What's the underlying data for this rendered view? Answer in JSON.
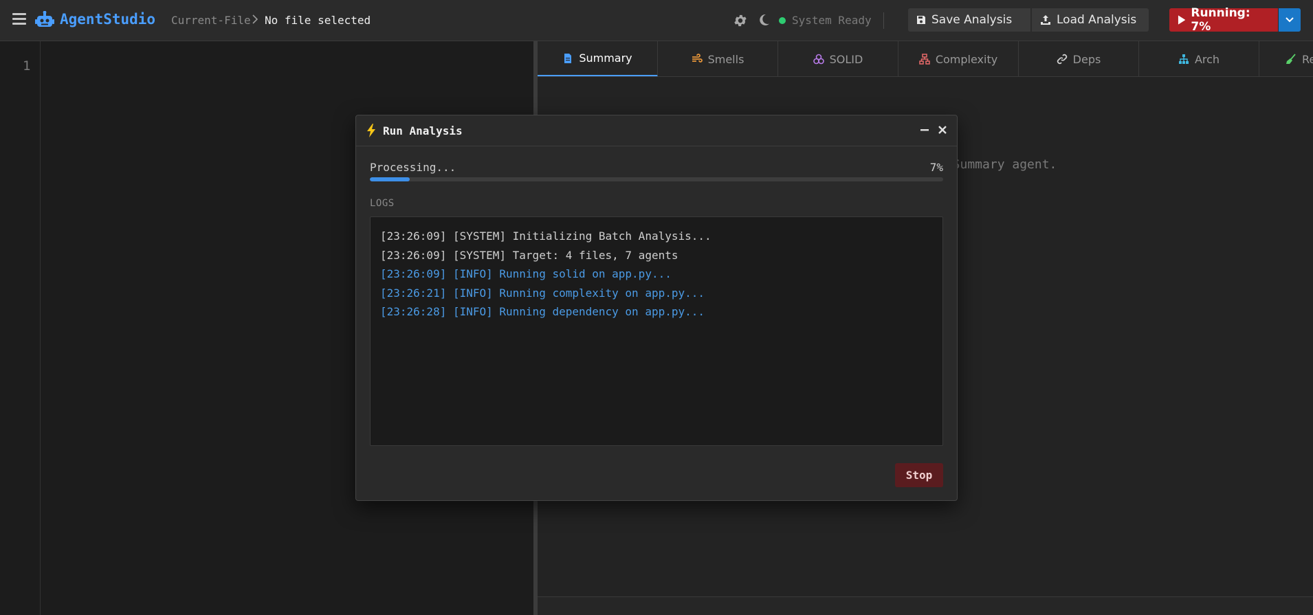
{
  "app": {
    "name": "AgentStudio"
  },
  "breadcrumb": {
    "root": "Current-File",
    "current": "No file selected"
  },
  "header": {
    "status": "System Ready",
    "save_label": "Save Analysis",
    "load_label": "Load Analysis",
    "run_label": "Running: 7%"
  },
  "editor": {
    "line_number": "1"
  },
  "tabs": [
    {
      "label": "Summary",
      "icon": "document-icon",
      "color": "#4a9eff"
    },
    {
      "label": "Smells",
      "icon": "wind-icon",
      "color": "#e8963a"
    },
    {
      "label": "SOLID",
      "icon": "cubes-icon",
      "color": "#b77be8"
    },
    {
      "label": "Complexity",
      "icon": "sitemap-icon",
      "color": "#e86a6a"
    },
    {
      "label": "Deps",
      "icon": "link-icon",
      "color": "#cfcfcf"
    },
    {
      "label": "Arch",
      "icon": "network-icon",
      "color": "#3fb8e0"
    },
    {
      "label": "Re",
      "icon": "broom-icon",
      "color": "#5ad06a"
    }
  ],
  "panel": {
    "hint": "e Summary agent."
  },
  "modal": {
    "title": "Run Analysis",
    "progress_label": "Processing...",
    "progress_text": "7%",
    "progress_value": 0.07,
    "logs_title": "LOGS",
    "logs": [
      {
        "text": "[23:26:09] [SYSTEM] Initializing Batch Analysis...",
        "level": "system"
      },
      {
        "text": "[23:26:09] [SYSTEM] Target: 4 files, 7 agents",
        "level": "system"
      },
      {
        "text": "[23:26:09] [INFO] Running solid on app.py...",
        "level": "info"
      },
      {
        "text": "[23:26:21] [INFO] Running complexity on app.py...",
        "level": "info"
      },
      {
        "text": "[23:26:28] [INFO] Running dependency on app.py...",
        "level": "info"
      }
    ],
    "stop_label": "Stop"
  },
  "colors": {
    "accent": "#4a9eff",
    "run": "#b02025",
    "run_dropdown": "#1a78c8",
    "status_ok": "#2ecc71",
    "stop": "#5a1c1f"
  }
}
